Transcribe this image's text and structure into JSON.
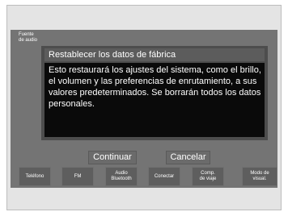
{
  "top": {
    "source_label_line1": "Fuente",
    "source_label_line2": "de audio"
  },
  "dialog": {
    "title": "Restablecer los datos de fábrica",
    "body": "Esto restaurará los ajustes del sistema, como el brillo, el volumen y las preferencias de enrutamiento, a sus valores predeterminados. Se borrarán todos los datos personales.",
    "continue_label": "Continuar",
    "cancel_label": "Cancelar"
  },
  "nav": {
    "phone": "Teléfono",
    "fm": "FM",
    "audio_bt_line1": "Audio",
    "audio_bt_line2": "Bluetooth",
    "connect": "Conectar",
    "trip_line1": "Comp.",
    "trip_line2": "de viaje",
    "display_line1": "Modo de",
    "display_line2": "visual."
  }
}
